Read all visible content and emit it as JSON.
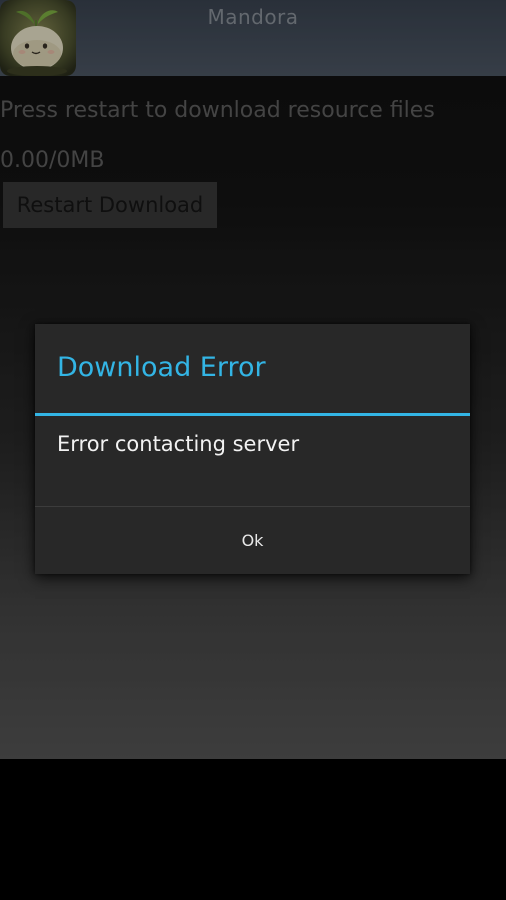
{
  "app": {
    "title": "Mandora",
    "icon": "sprout-mascot-icon"
  },
  "main": {
    "message": "Press restart to download resource files",
    "progress_text": "0.00/0MB",
    "restart_label": "Restart Download"
  },
  "dialog": {
    "title": "Download Error",
    "message": "Error contacting server",
    "ok_label": "Ok"
  },
  "colors": {
    "accent": "#33b5e5",
    "dialog_bg": "#282828",
    "titlebar": "#444d59"
  }
}
